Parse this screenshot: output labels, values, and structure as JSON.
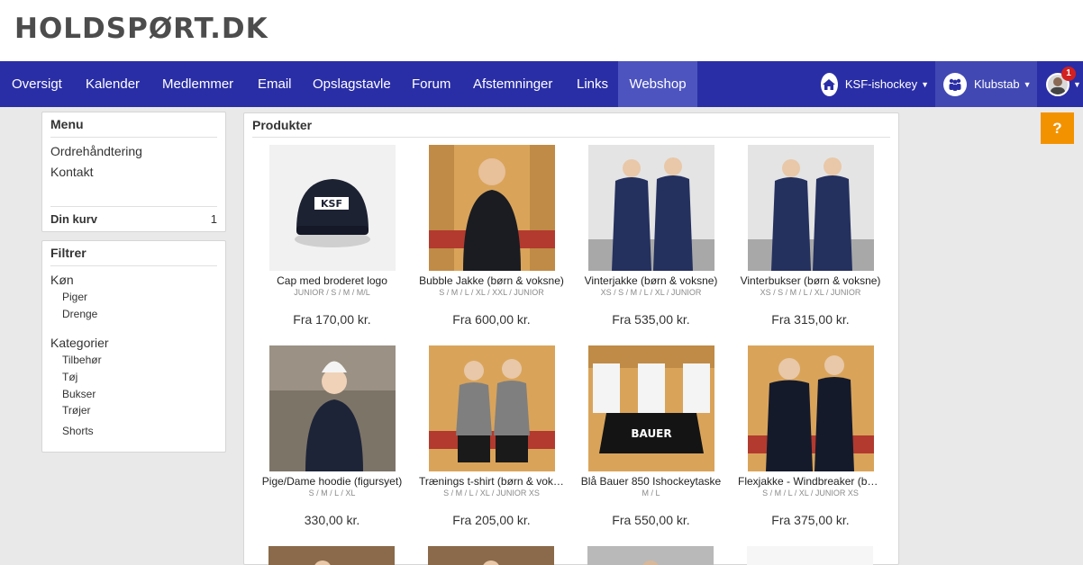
{
  "logo": "HOLDSPØRT.DK",
  "nav": {
    "items": [
      "Oversigt",
      "Kalender",
      "Medlemmer",
      "Email",
      "Opslagstavle",
      "Forum",
      "Afstemninger",
      "Links",
      "Webshop"
    ],
    "active": "Webshop",
    "team_label": "KSF-ishockey",
    "club_label": "Klubstab",
    "notification_count": "1",
    "icons": [
      "home-icon",
      "people-icon",
      "avatar-icon"
    ]
  },
  "help_label": "?",
  "menu": {
    "title": "Menu",
    "links": [
      "Ordrehåndtering",
      "Kontakt"
    ],
    "cart_label": "Din kurv",
    "cart_count": "1"
  },
  "filter": {
    "title": "Filtrer",
    "gender_head": "Køn",
    "gender_opts": [
      "Piger",
      "Drenge"
    ],
    "cat_head": "Kategorier",
    "cat_opts": [
      "Tilbehør",
      "Tøj",
      "Bukser",
      "Trøjer",
      "Shorts"
    ]
  },
  "products": {
    "title": "Produkter",
    "items": [
      {
        "name": "Cap med broderet logo",
        "sizes": "JUNIOR / S / M / M/L",
        "price": "Fra 170,00 kr."
      },
      {
        "name": "Bubble Jakke (børn & voksne)",
        "sizes": "S / M / L / XL / XXL / JUNIOR",
        "price": "Fra 600,00 kr."
      },
      {
        "name": "Vinterjakke (børn & voksne)",
        "sizes": "XS / S / M / L / XL / JUNIOR",
        "price": "Fra 535,00 kr."
      },
      {
        "name": "Vinterbukser (børn & voksne)",
        "sizes": "XS / S / M / L / XL / JUNIOR",
        "price": "Fra 315,00 kr."
      },
      {
        "name": "Pige/Dame hoodie (figursyet)",
        "sizes": "S / M / L / XL",
        "price": "330,00 kr."
      },
      {
        "name": "Trænings t-shirt (børn & voksne)",
        "sizes": "S / M / L / XL / JUNIOR XS",
        "price": "Fra 205,00 kr."
      },
      {
        "name": "Blå Bauer 850 Ishockeytaske",
        "sizes": "M / L",
        "price": "Fra 550,00 kr."
      },
      {
        "name": "Flexjakke - Windbreaker (børn & voksne)",
        "sizes": "S / M / L / XL / JUNIOR XS",
        "price": "Fra 375,00 kr."
      }
    ]
  },
  "colors": {
    "nav_bg": "#2a2ea6",
    "nav_active": "#4d54bf",
    "help": "#f39200",
    "badge": "#d32020"
  }
}
